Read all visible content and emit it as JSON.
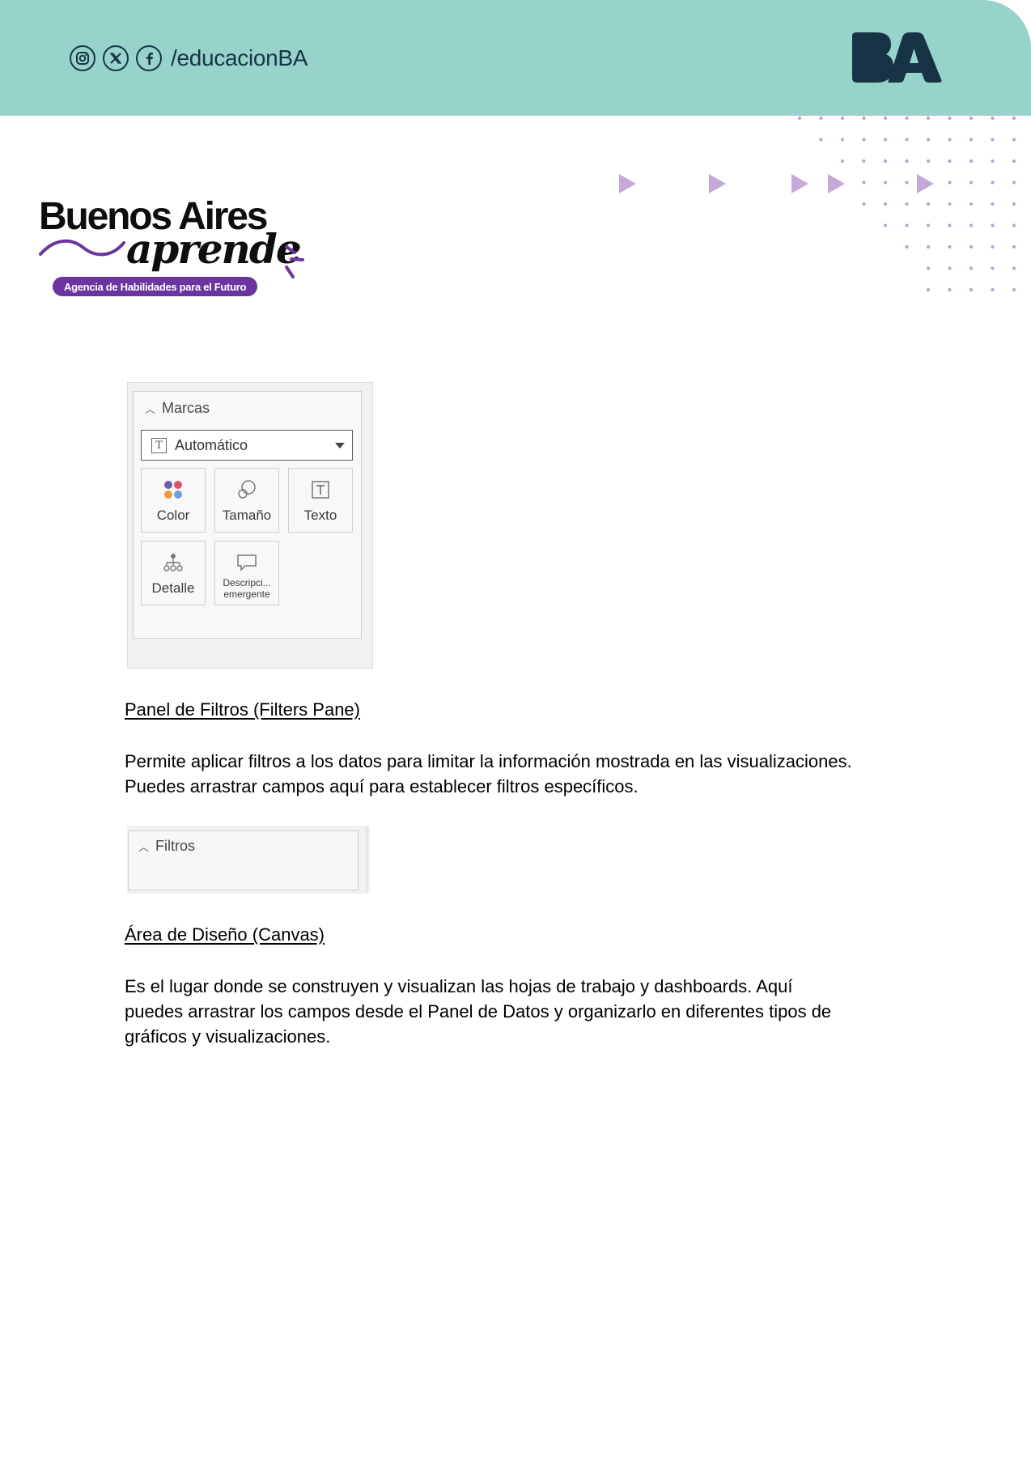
{
  "header": {
    "handle": "/educacionBA",
    "social_icons": [
      "instagram-icon",
      "x-icon",
      "facebook-icon"
    ],
    "logo_text": "BA",
    "bg_color": "#97d3cb",
    "brand_color": "#173447"
  },
  "brand": {
    "title": "Buenos Aires",
    "script": "aprende",
    "tagline": "Agencia de Habilidades para el Futuro",
    "accent_color": "#6b35a0"
  },
  "marcas_panel": {
    "title": "Marcas",
    "dropdown_value": "Automático",
    "cards": [
      {
        "label": "Color",
        "icon": "color-dots-icon"
      },
      {
        "label": "Tamaño",
        "icon": "size-circles-icon"
      },
      {
        "label": "Texto",
        "icon": "text-box-icon"
      },
      {
        "label": "Detalle",
        "icon": "hierarchy-icon"
      },
      {
        "label": "Descripci...",
        "label2": "emergente",
        "icon": "speech-bubble-icon"
      }
    ]
  },
  "sections": [
    {
      "heading": "Panel de Filtros (Filters Pane)",
      "lines": [
        "Permite aplicar filtros a los datos para limitar la información mostrada en las visualizaciones.",
        "Puedes arrastrar campos aquí para establecer filtros específicos."
      ]
    },
    {
      "heading": "Área de Diseño (Canvas)",
      "lines": [
        "Es el lugar donde se construyen y visualizan las hojas de trabajo y dashboards. Aquí",
        "puedes arrastrar los campos desde el Panel de Datos y organizarlo en diferentes tipos de",
        "gráficos y visualizaciones."
      ]
    }
  ],
  "filtros_panel": {
    "title": "Filtros"
  }
}
